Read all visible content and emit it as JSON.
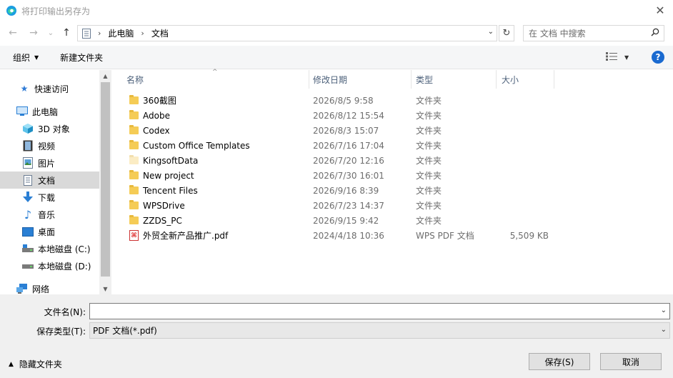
{
  "window": {
    "title": "将打印输出另存为",
    "close_glyph": "✕",
    "colors": {
      "accent": "#0078d7",
      "help": "#1a6ad0",
      "folder": "#f5cc56"
    }
  },
  "nav": {
    "back_glyph": "←",
    "forward_glyph": "→",
    "recent_glyph": "⌄",
    "up_glyph": "↑"
  },
  "address": {
    "segments": [
      "此电脑",
      "文档"
    ],
    "separator": "›",
    "dropdown_glyph": "⌄",
    "refresh_glyph": "↻"
  },
  "search": {
    "placeholder": "在 文档 中搜索",
    "icon": "search-icon"
  },
  "toolbar": {
    "organize_label": "组织",
    "new_folder_label": "新建文件夹",
    "help_label": "?"
  },
  "sidebar": {
    "items": [
      {
        "label": "快速访问",
        "icon": "star-icon",
        "glyph": "★",
        "color": "#2f7bd6"
      },
      {
        "label": "此电脑",
        "icon": "computer-icon",
        "glyph": "▭",
        "color": "#2a7fd4"
      },
      {
        "label": "3D 对象",
        "icon": "cube-icon",
        "glyph": "◆",
        "color": "#29a3d6"
      },
      {
        "label": "视频",
        "icon": "film-icon",
        "glyph": "▦",
        "color": "#444"
      },
      {
        "label": "图片",
        "icon": "picture-icon",
        "glyph": "▣",
        "color": "#3a86c8"
      },
      {
        "label": "文档",
        "icon": "document-icon",
        "glyph": "▤",
        "color": "#5a6f86"
      },
      {
        "label": "下载",
        "icon": "download-icon",
        "glyph": "⬇",
        "color": "#2a7fd4"
      },
      {
        "label": "音乐",
        "icon": "music-icon",
        "glyph": "♪",
        "color": "#2a7fd4"
      },
      {
        "label": "桌面",
        "icon": "desktop-icon",
        "glyph": "▬",
        "color": "#2a7fd4"
      },
      {
        "label": "本地磁盘 (C:)",
        "icon": "drive-c-icon",
        "glyph": "▭",
        "color": "#555"
      },
      {
        "label": "本地磁盘 (D:)",
        "icon": "drive-d-icon",
        "glyph": "▭",
        "color": "#555"
      },
      {
        "label": "网络",
        "icon": "network-icon",
        "glyph": "⛁",
        "color": "#2a7fd4"
      }
    ],
    "selected": "文档"
  },
  "columns": [
    "名称",
    "修改日期",
    "类型",
    "大小"
  ],
  "files": [
    {
      "name": "360截图",
      "date": "2026/8/5 9:58",
      "type": "文件夹",
      "size": "",
      "kind": "folder"
    },
    {
      "name": "Adobe",
      "date": "2026/8/12 15:54",
      "type": "文件夹",
      "size": "",
      "kind": "folder"
    },
    {
      "name": "Codex",
      "date": "2026/8/3 15:07",
      "type": "文件夹",
      "size": "",
      "kind": "folder"
    },
    {
      "name": "Custom Office Templates",
      "date": "2026/7/16 17:04",
      "type": "文件夹",
      "size": "",
      "kind": "folder"
    },
    {
      "name": "KingsoftData",
      "date": "2026/7/20 12:16",
      "type": "文件夹",
      "size": "",
      "kind": "folder-light"
    },
    {
      "name": "New project",
      "date": "2026/7/30 16:01",
      "type": "文件夹",
      "size": "",
      "kind": "folder"
    },
    {
      "name": "Tencent Files",
      "date": "2026/9/16 8:39",
      "type": "文件夹",
      "size": "",
      "kind": "folder"
    },
    {
      "name": "WPSDrive",
      "date": "2026/7/23 14:37",
      "type": "文件夹",
      "size": "",
      "kind": "folder"
    },
    {
      "name": "ZZDS_PC",
      "date": "2026/9/15 9:42",
      "type": "文件夹",
      "size": "",
      "kind": "folder"
    },
    {
      "name": "外贸全新产品推广.pdf",
      "date": "2024/4/18 10:36",
      "type": "WPS PDF 文档",
      "size": "5,509 KB",
      "kind": "pdf"
    }
  ],
  "form": {
    "filename_label": "文件名(N):",
    "filename_value": "",
    "filetype_label": "保存类型(T):",
    "filetype_value": "PDF 文档(*.pdf)"
  },
  "footer": {
    "hide_folders_label": "隐藏文件夹",
    "save_label": "保存(S)",
    "cancel_label": "取消"
  }
}
